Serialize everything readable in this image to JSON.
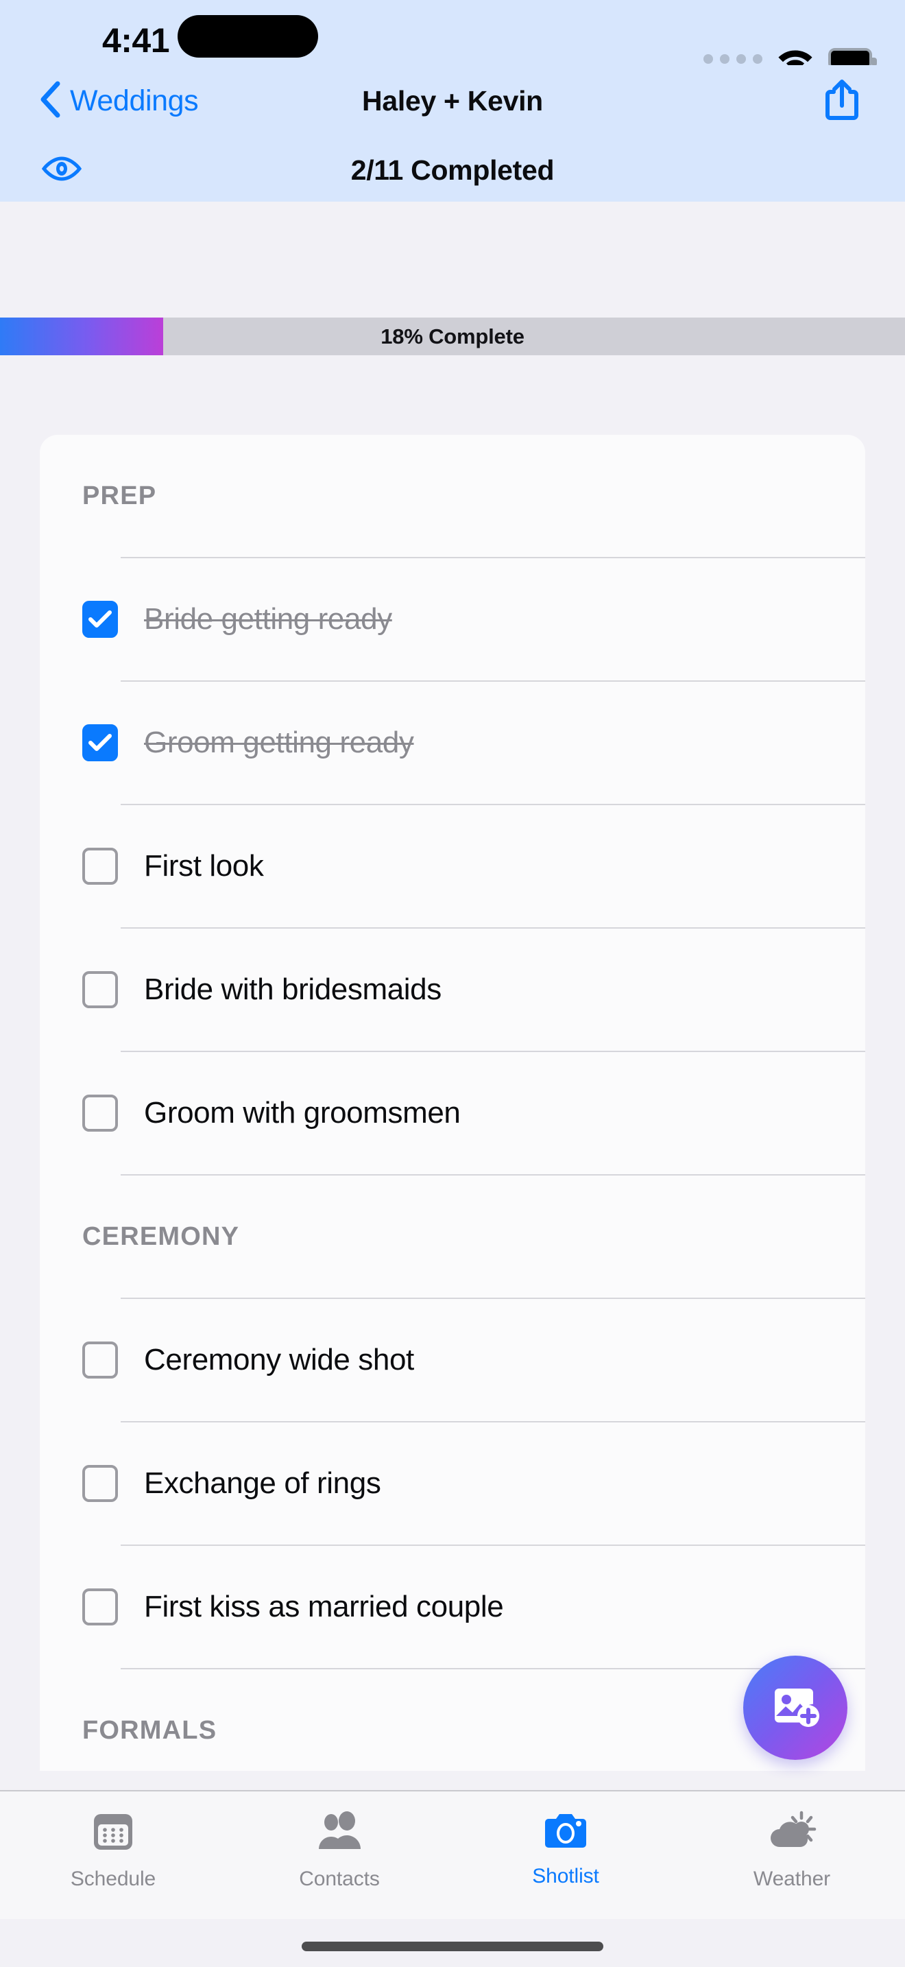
{
  "status_bar": {
    "time": "4:41",
    "signal_icon": "signal-dots-icon",
    "wifi_icon": "wifi-icon",
    "battery_icon": "battery-full-icon"
  },
  "nav": {
    "back_label": "Weddings",
    "back_icon": "chevron-left-icon",
    "title": "Haley + Kevin",
    "share_icon": "share-icon"
  },
  "subtitle": {
    "visibility_icon": "eye-icon",
    "completed_text": "2/11 Completed"
  },
  "progress": {
    "label": "18% Complete",
    "percent": 18,
    "gradient_start": "#2f7bf6",
    "gradient_end": "#bb3fd8",
    "track_color": "#cfcfd6"
  },
  "shotlist": {
    "sections": [
      {
        "title": "PREP",
        "items": [
          {
            "label": "Bride getting ready",
            "checked": true
          },
          {
            "label": "Groom getting ready",
            "checked": true
          },
          {
            "label": "First look",
            "checked": false
          },
          {
            "label": "Bride with bridesmaids",
            "checked": false
          },
          {
            "label": "Groom with groomsmen",
            "checked": false
          }
        ]
      },
      {
        "title": "CEREMONY",
        "items": [
          {
            "label": "Ceremony wide shot",
            "checked": false
          },
          {
            "label": "Exchange of rings",
            "checked": false
          },
          {
            "label": "First kiss as married couple",
            "checked": false
          }
        ]
      },
      {
        "title": "FORMALS",
        "items": []
      }
    ]
  },
  "fab": {
    "icon": "add-photo-icon",
    "accent_start": "#4a7df8",
    "accent_end": "#b545e0"
  },
  "tabbar": {
    "active_color": "#0a7afe",
    "inactive_color": "#8a8a90",
    "items": [
      {
        "label": "Schedule",
        "icon": "calendar-icon",
        "active": false
      },
      {
        "label": "Contacts",
        "icon": "people-icon",
        "active": false
      },
      {
        "label": "Shotlist",
        "icon": "camera-icon",
        "active": true
      },
      {
        "label": "Weather",
        "icon": "sun-cloud-icon",
        "active": false
      }
    ]
  }
}
